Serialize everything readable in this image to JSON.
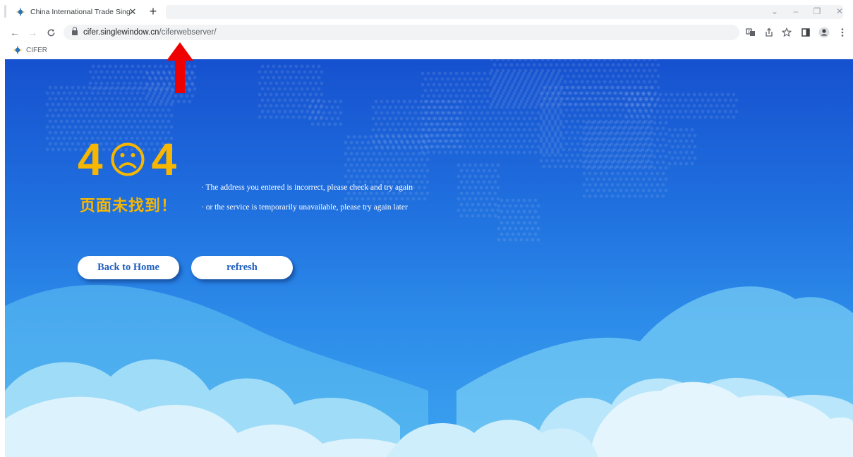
{
  "browser": {
    "tab": {
      "title": "China International Trade Single",
      "close_glyph": "✕"
    },
    "new_tab_glyph": "+",
    "window_controls": {
      "dropdown": "⌄",
      "minimize": "–",
      "restore": "❐",
      "close": "✕"
    },
    "nav": {
      "back": "←",
      "forward": "→",
      "reload": "C"
    },
    "url": {
      "host": "cifer.singlewindow.cn",
      "path": "/ciferwebserver/"
    },
    "toolbar_icons": [
      "translate-icon",
      "share-icon",
      "star-icon",
      "side-panel-icon",
      "profile-icon",
      "menu-icon"
    ],
    "bookmarks": [
      {
        "label": "CIFER"
      }
    ]
  },
  "error_page": {
    "code_left": "4",
    "code_right": "4",
    "title": "页面未找到！",
    "lines": [
      "· The address you entered is incorrect, please check and try again",
      "· or the service is temporarily unavailable, please try again later"
    ],
    "buttons": {
      "home": "Back to Home",
      "refresh": "refresh"
    }
  },
  "colors": {
    "accent_yellow": "#f7b600",
    "background_top": "#1651cf",
    "background_bottom": "#3da3f0",
    "button_text": "#1f5fbf",
    "annotation_arrow": "#ee0000"
  }
}
